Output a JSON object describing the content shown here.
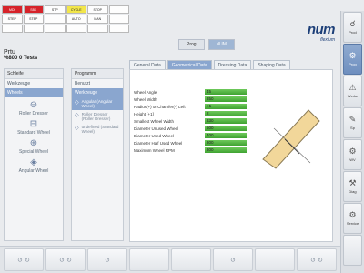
{
  "status": [
    "MDI",
    "SBK",
    "STP",
    "CYCLE",
    "STOP",
    "",
    "STEP",
    "STEP",
    "",
    "AUTO",
    "MAN",
    "",
    "",
    "",
    "",
    "",
    "",
    ""
  ],
  "toolbar": {
    "prog_label": "Prog",
    "mode_label": "NUM"
  },
  "logo": {
    "main": "num",
    "sub": "flexium"
  },
  "page": {
    "title1": "Prtu",
    "title2": "%800 0 Tests"
  },
  "col_a": {
    "header": "Schleife",
    "rows": [
      "Werkzeuge",
      "Wheels"
    ],
    "selected": 1,
    "items": [
      {
        "icon": "⊖",
        "name": "Roller Dresser"
      },
      {
        "icon": "⊟",
        "name": "Standard Wheel"
      },
      {
        "icon": "⊕",
        "name": "Special Wheel"
      },
      {
        "icon": "◈",
        "name": "Angular Wheel"
      }
    ]
  },
  "col_b": {
    "header": "Programm",
    "rows": [
      "Benutzt",
      "Werkzeuge"
    ],
    "selected": 1,
    "items": [
      {
        "icon": "◇",
        "name": "Angular (Angular Wheel)",
        "selected": true
      },
      {
        "icon": "◇",
        "name": "Roller Dresser (Roller Dresser)",
        "selected": false
      },
      {
        "icon": "◇",
        "name": "undefined (Standard Wheel)",
        "selected": false
      }
    ]
  },
  "tabs": [
    "General Data",
    "Geometrical Data",
    "Dressing Data",
    "Shaping Data"
  ],
  "active_tab": 1,
  "params": [
    {
      "label": "Wheel Angle",
      "value": "45"
    },
    {
      "label": "Wheel Width",
      "value": "350"
    },
    {
      "label": "Radius(+) or Chamfer(-) Left",
      "value": "+5"
    },
    {
      "label": "Height [+1]",
      "value": "2"
    },
    {
      "label": "Smallest Wheel Width",
      "value": "330"
    },
    {
      "label": "Diameter Unused Wheel",
      "value": "500"
    },
    {
      "label": "Diameter Used Wheel",
      "value": "400"
    },
    {
      "label": "Diameter Half Used Wheel",
      "value": "300"
    },
    {
      "label": "Maximum Wheel RPM",
      "value": "300"
    }
  ],
  "rail": [
    {
      "icon": "☌",
      "label": "Prod"
    },
    {
      "icon": "⚙",
      "label": "Prog",
      "active": true
    },
    {
      "icon": "⚠",
      "label": "Werkz"
    },
    {
      "icon": "✎",
      "label": "Sp"
    },
    {
      "icon": "⚙",
      "label": "WV"
    },
    {
      "icon": "⚒",
      "label": "Diag"
    },
    {
      "icon": "⚙",
      "label": "Service"
    },
    {
      "icon": "",
      "label": ""
    }
  ],
  "bottom": [
    "↺ ↻",
    "↺ ↻",
    "↺",
    "",
    "",
    "↺",
    "",
    "↺ ↻"
  ]
}
